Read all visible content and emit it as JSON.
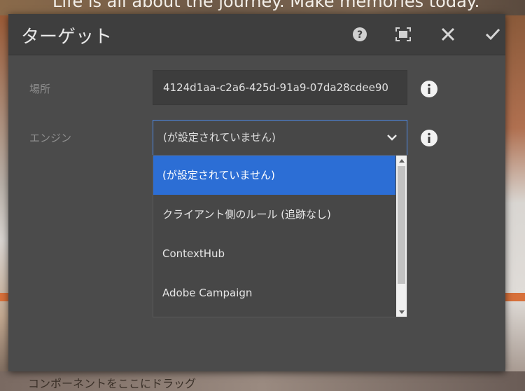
{
  "background": {
    "headline": "Life is all about the journey. Make memories today.",
    "bottom_text": "コンポーネントをここにドラッグ",
    "accent_color": "#d7703a"
  },
  "dialog": {
    "title": "ターゲット",
    "header_icons": [
      "help-icon",
      "fullscreen-icon",
      "close-icon",
      "check-icon"
    ],
    "fields": {
      "location": {
        "label": "場所",
        "value": "4124d1aa-c2a6-425d-91a9-07da28cdee90"
      },
      "engine": {
        "label": "エンジン",
        "value": "(が設定されていません)",
        "options": [
          "(が設定されていません)",
          "クライアント側のルール (追跡なし)",
          "ContextHub",
          "Adobe Campaign"
        ],
        "selected_index": 0
      }
    },
    "colors": {
      "background": "#4b4b4b",
      "header": "#3e3e3e",
      "selection": "#2c6ed5",
      "focus_border": "#4e8ae6"
    }
  }
}
